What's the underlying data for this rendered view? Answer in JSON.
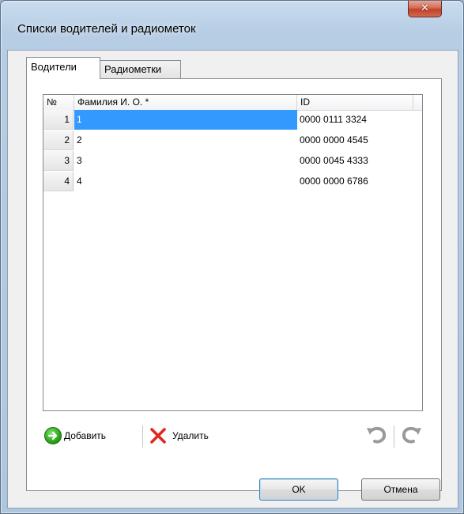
{
  "window": {
    "title": "Списки водителей и радиометок",
    "close_glyph": "✕"
  },
  "tabs": [
    {
      "label": "Водители",
      "active": true
    },
    {
      "label": "Радиометки",
      "active": false
    }
  ],
  "table": {
    "columns": [
      "№",
      "Фамилия И. О. *",
      "ID"
    ],
    "rows": [
      {
        "num": "1",
        "name": "1",
        "id": "0000 0111 3324",
        "selected": true
      },
      {
        "num": "2",
        "name": "2",
        "id": "0000 0000 4545",
        "selected": false
      },
      {
        "num": "3",
        "name": "3",
        "id": "0000 0045 4333",
        "selected": false
      },
      {
        "num": "4",
        "name": "4",
        "id": "0000 0000 6786",
        "selected": false
      }
    ]
  },
  "toolbar": {
    "add_label": "Добавить",
    "delete_label": "Удалить",
    "icons": [
      "arrow-right-circle-icon",
      "red-x-icon",
      "undo-icon",
      "redo-icon"
    ]
  },
  "buttons": {
    "ok": "OK",
    "cancel": "Отмена"
  },
  "colors": {
    "selection": "#3399ff",
    "add_icon": "#2aa31a",
    "delete_icon": "#e0281c",
    "disabled_icon": "#9a9a9a"
  }
}
